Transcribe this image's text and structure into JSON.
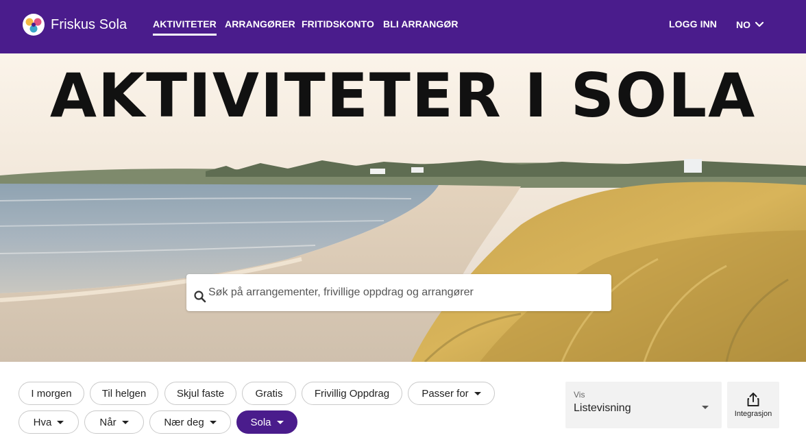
{
  "brand": {
    "name": "Friskus Sola",
    "logo_icon": "friskus-logo-icon"
  },
  "nav": {
    "items": [
      {
        "label": "AKTIVITETER",
        "active": true
      },
      {
        "label": "ARRANGØRER",
        "active": false
      },
      {
        "label": "FRITIDSKONTO",
        "active": false
      },
      {
        "label": "BLI ARRANGØR",
        "active": false
      }
    ],
    "login": "LOGG INN",
    "language": "NO",
    "language_icon": "chevron-down-icon"
  },
  "hero": {
    "title": "AKTIVITETER I SOLA",
    "search_placeholder": "Søk på arrangementer, frivillige oppdrag og arrangører",
    "search_value": "",
    "search_icon": "search-icon"
  },
  "filters": {
    "chips": [
      {
        "label": "I morgen",
        "dropdown": false,
        "selected": false
      },
      {
        "label": "Til helgen",
        "dropdown": false,
        "selected": false
      },
      {
        "label": "Skjul faste",
        "dropdown": false,
        "selected": false
      },
      {
        "label": "Gratis",
        "dropdown": false,
        "selected": false
      },
      {
        "label": "Frivillig Oppdrag",
        "dropdown": false,
        "selected": false
      },
      {
        "label": "Passer for",
        "dropdown": true,
        "selected": false
      },
      {
        "label": "Hva",
        "dropdown": true,
        "selected": false
      },
      {
        "label": "Når",
        "dropdown": true,
        "selected": false
      },
      {
        "label": "Nær deg",
        "dropdown": true,
        "selected": false
      },
      {
        "label": "Sola",
        "dropdown": true,
        "selected": true
      }
    ]
  },
  "view": {
    "label": "Vis",
    "value": "Listevisning"
  },
  "integration": {
    "label": "Integrasjon",
    "icon": "share-icon"
  },
  "colors": {
    "brand_purple": "#4a1c8c",
    "chip_border": "#c9c9c9",
    "panel_bg": "#f2f2f2"
  }
}
